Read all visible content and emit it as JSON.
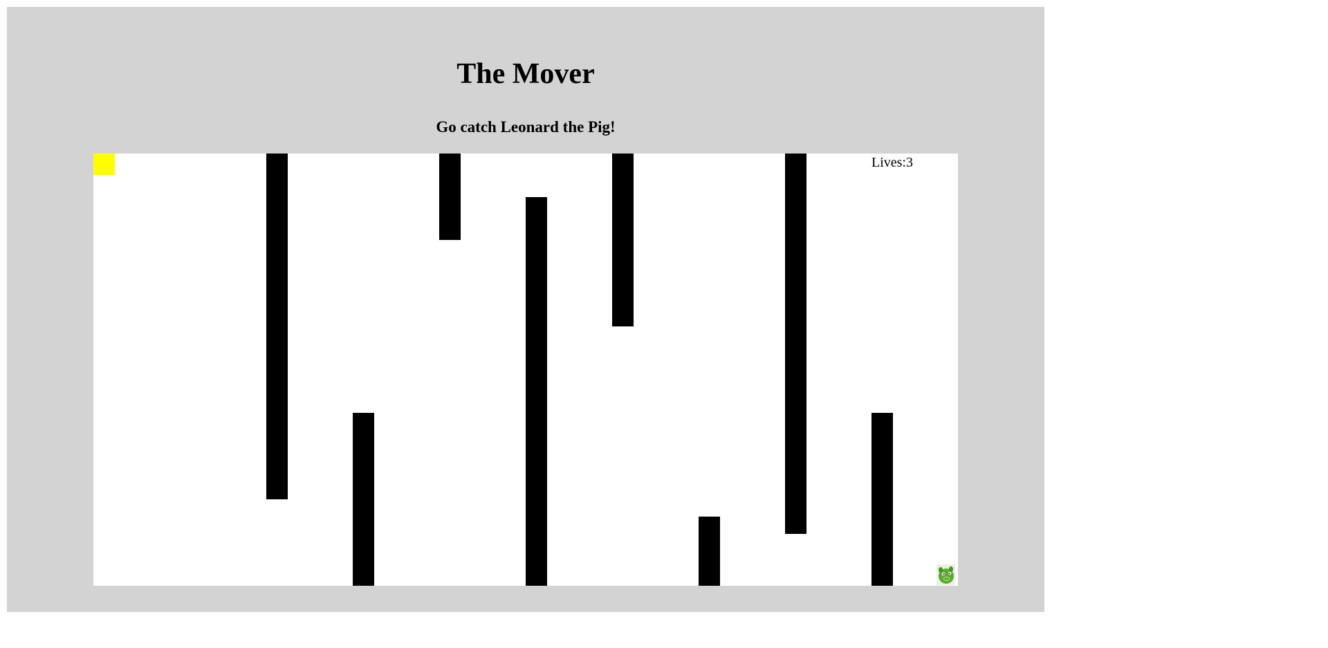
{
  "game": {
    "title": "The Mover",
    "subtitle": "Go catch Leonard the Pig!",
    "lives_label": "Lives:3",
    "lives": 3
  },
  "colors": {
    "frame_background": "#d3d3d3",
    "board_background": "#ffffff",
    "wall": "#000000",
    "player": "#ffff00",
    "pig": "#5aa832"
  },
  "sprites": {
    "player": "yellow-square",
    "target": "green-pig-icon"
  }
}
